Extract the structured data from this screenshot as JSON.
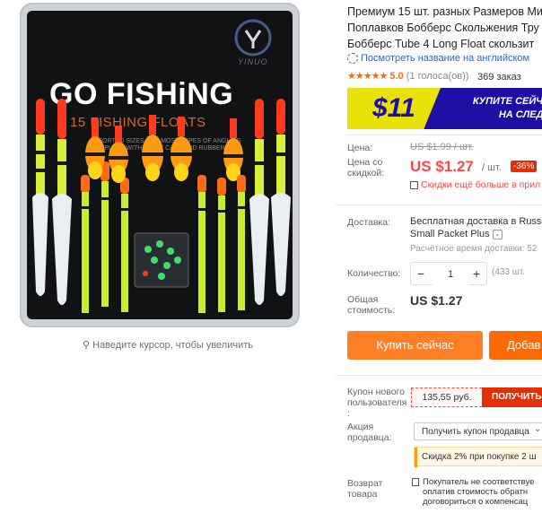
{
  "image": {
    "brand_logo_text": "YINUO",
    "headline": "GO FISHiNG",
    "subline": "15 FISHING FLOATS",
    "fineprint": "ASSORTED SIZES FOR MOST TYPES OF ANGLING COMPLETE WITH FLOAT CAPS AND RUBBERS",
    "zoom_hint": "Наведите курсор, чтобы увеличить"
  },
  "product": {
    "title_lines": [
      "Премиум 15 шт. разных Размеров Ми",
      "Поплавков Бобберс Скольжения Тру",
      "Бобберс Tube 4 Long Float скользит"
    ],
    "translate_link": "Посмотреть название на английском",
    "stars": "★★★★★",
    "rating": "5.0",
    "rating_count": "(1 голоса(ов))",
    "orders": "369 заказ"
  },
  "banner": {
    "coupon_value": "$11",
    "line1": "КУПИТЕ СЕЙЧА",
    "line2": "НА СЛЕДУ"
  },
  "pricing": {
    "price_label": "Цена:",
    "old_price": "US $1.99 / шт.",
    "discount_label": "Цена со скидкой:",
    "price": "US $1.27",
    "per_unit": "/ шт.",
    "discount_badge": "-36%",
    "qr_text": "Скидки ещё больше в прил"
  },
  "shipping": {
    "label": "Доставка:",
    "main": "Бесплатная доставка в Russi",
    "method": "Small Packet Plus",
    "time": "Расчётное время доставки: 52"
  },
  "quantity": {
    "label": "Количество:",
    "minus": "−",
    "value": "1",
    "plus": "+",
    "available": "(433 шт."
  },
  "total": {
    "label": "Общая стоимость:",
    "value": "US $1.27"
  },
  "buttons": {
    "buy_now": "Купить сейчас",
    "add_to_cart": "Добав"
  },
  "coupon": {
    "label": "Купон нового пользователя :",
    "amount": "135,55 руб.",
    "get": "ПОЛУЧИТЬ"
  },
  "promo": {
    "label": "Акция продавца:",
    "select": "Получить купон продавца",
    "discount": "Скидка 2% при покупке 2 ш"
  },
  "returns": {
    "label": "Возврат товара",
    "lines": [
      "Покупатель не соответствуе",
      "оплатив стоимость обратн",
      "договориться о компенсац"
    ]
  },
  "colors": {
    "accent": "#ff4747",
    "buy_button": "#ff7f22",
    "cart_button": "#ff6a00",
    "link": "#2b67c6",
    "banner_bg": "#1d0fa3",
    "banner_coupon": "#e9e10a"
  }
}
